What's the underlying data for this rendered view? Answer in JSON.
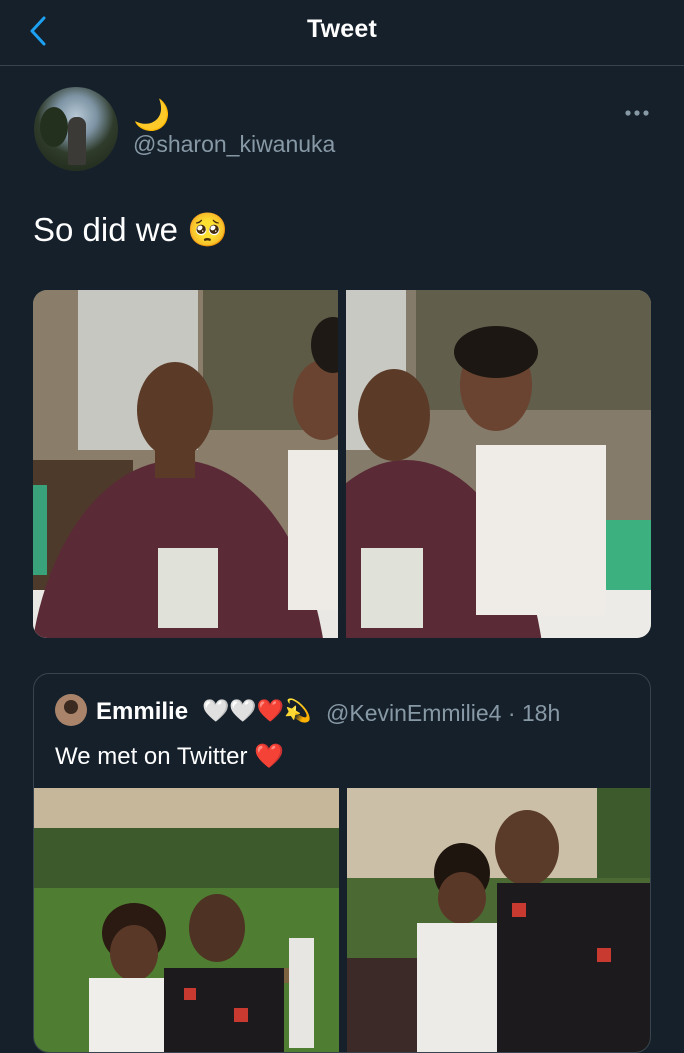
{
  "header": {
    "title": "Tweet"
  },
  "tweet": {
    "display_name": "🌙",
    "handle": "@sharon_kiwanuka",
    "text": "So did we 🥺"
  },
  "quoted": {
    "name": "Emmilie",
    "emojis": "🤍🤍❤️💫",
    "handle": "@KevinEmmilie4 · 18h",
    "text": "We met on Twitter ❤️"
  },
  "colors": {
    "background": "#15202b",
    "accent": "#1da1f2",
    "secondary_text": "#8899a6",
    "border": "#38444d"
  }
}
